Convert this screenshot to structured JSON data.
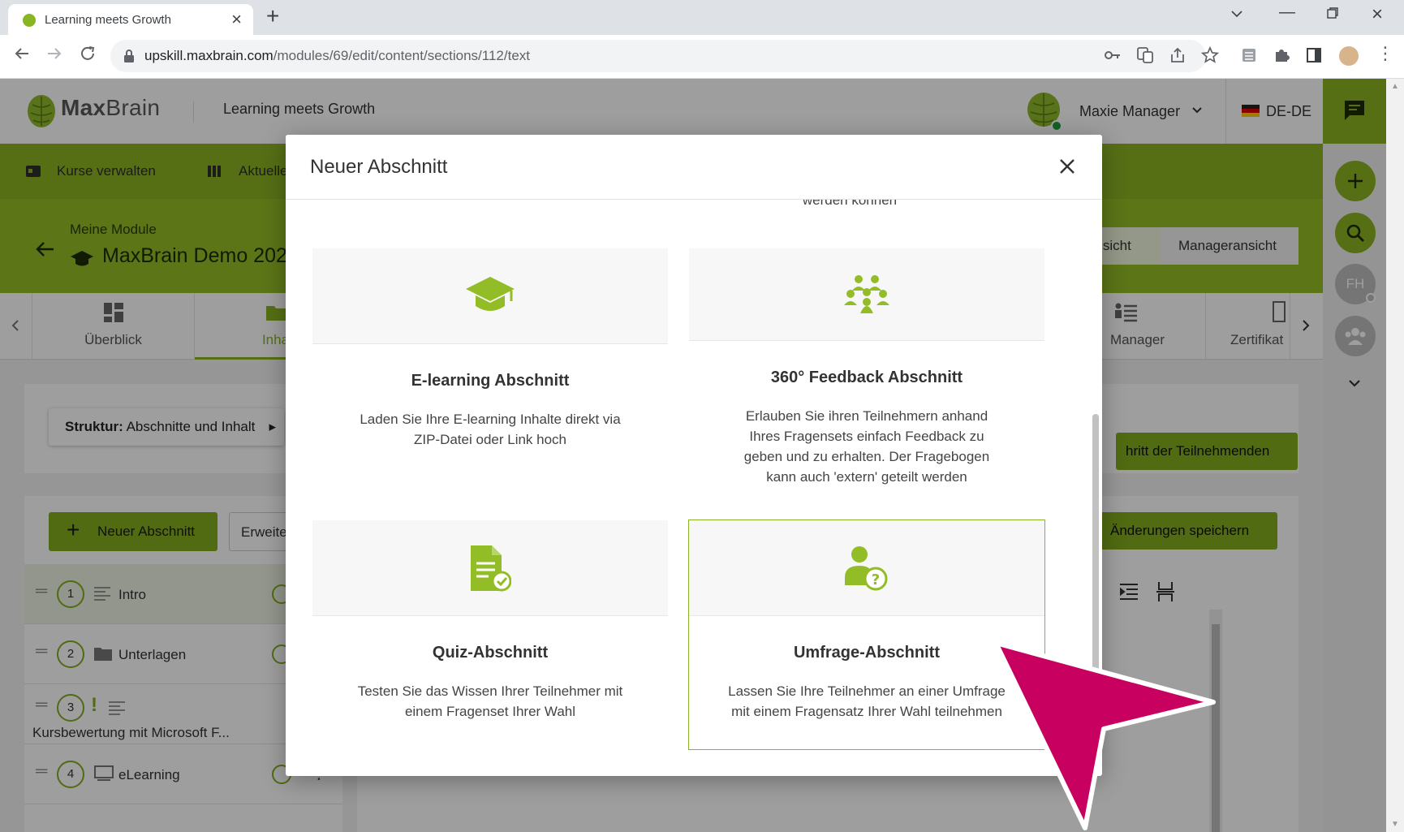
{
  "browser": {
    "tab_title": "Learning meets Growth",
    "url_domain": "upskill.maxbrain.com",
    "url_path": "/modules/69/edit/content/sections/112/text"
  },
  "header": {
    "logo_bold": "Max",
    "logo_light": "Brain",
    "tagline": "Learning meets Growth",
    "user_name": "Maxie Manager",
    "language": "DE-DE"
  },
  "nav": {
    "items": [
      {
        "label": "Kurse verwalten"
      },
      {
        "label": "Aktuelle"
      }
    ]
  },
  "hero": {
    "breadcrumb": "Meine Module",
    "module_title": "MaxBrain Demo 202",
    "view_options": [
      "ansicht",
      "Manageransicht"
    ]
  },
  "tabs": [
    {
      "label": "Überblick"
    },
    {
      "label": "Inha"
    },
    {
      "label": "Manager"
    },
    {
      "label": "Zertifikat"
    }
  ],
  "structure": {
    "label_bold": "Struktur:",
    "label": "Abschnitte und Inhalt",
    "right_button": "hritt der Teilnehmenden"
  },
  "sections_panel": {
    "new_button": "Neuer Abschnitt",
    "extended_button": "Erweite",
    "save_button": "Änderungen speichern",
    "rows": [
      {
        "num": "1",
        "name": "Intro"
      },
      {
        "num": "2",
        "name": "Unterlagen"
      },
      {
        "num": "3",
        "name": "Kursbewertung mit Microsoft F..."
      },
      {
        "num": "4",
        "name": "eLearning"
      }
    ]
  },
  "rail": {
    "avatar_initials": "FH"
  },
  "modal": {
    "title": "Neuer Abschnitt",
    "cut_text": "werden können",
    "cards": [
      {
        "icon": "graduation-cap-icon",
        "title": "E-learning Abschnitt",
        "description": "Laden Sie Ihre E-learning Inhalte direkt via ZIP-Datei oder Link hoch"
      },
      {
        "icon": "group-icon",
        "title": "360° Feedback Abschnitt",
        "description": "Erlauben Sie ihren Teilnehmern anhand Ihres Fragensets einfach Feedback zu geben und zu erhalten. Der Fragebogen kann auch 'extern' geteilt werden"
      },
      {
        "icon": "quiz-document-icon",
        "title": "Quiz-Abschnitt",
        "description": "Testen Sie das Wissen Ihrer Teilnehmer mit einem Fragenset Ihrer Wahl"
      },
      {
        "icon": "survey-person-icon",
        "title": "Umfrage-Abschnitt",
        "description": "Lassen Sie Ihre Teilnehmer an einer Umfrage mit einem Fragensatz Ihrer Wahl teilnehmen"
      }
    ]
  },
  "colors": {
    "brand_green": "#8bb323",
    "icon_green": "#93bd26",
    "pointer_magenta": "#c8005f"
  }
}
